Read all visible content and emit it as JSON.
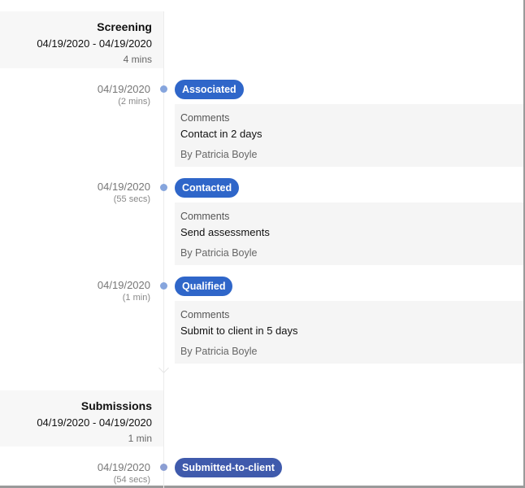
{
  "stages": [
    {
      "title": "Screening",
      "range": "04/19/2020 - 04/19/2020",
      "duration": "4 mins"
    },
    {
      "title": "Submissions",
      "range": "04/19/2020 - 04/19/2020",
      "duration": "1 min"
    }
  ],
  "events": [
    {
      "date": "04/19/2020",
      "elapsed": "(2 mins)",
      "status": "Associated",
      "comments_label": "Comments",
      "comment": "Contact in 2 days",
      "author": "By Patricia Boyle"
    },
    {
      "date": "04/19/2020",
      "elapsed": "(55 secs)",
      "status": "Contacted",
      "comments_label": "Comments",
      "comment": "Send assessments",
      "author": "By Patricia Boyle"
    },
    {
      "date": "04/19/2020",
      "elapsed": "(1 min)",
      "status": "Qualified",
      "comments_label": "Comments",
      "comment": "Submit to client in 5 days",
      "author": "By Patricia Boyle"
    },
    {
      "date": "04/19/2020",
      "elapsed": "(54 secs)",
      "status": "Submitted-to-client"
    }
  ],
  "colors": {
    "badge": "#2f66c9",
    "badge_submitted": "#3f5aac",
    "dot": "#86a5dd"
  }
}
